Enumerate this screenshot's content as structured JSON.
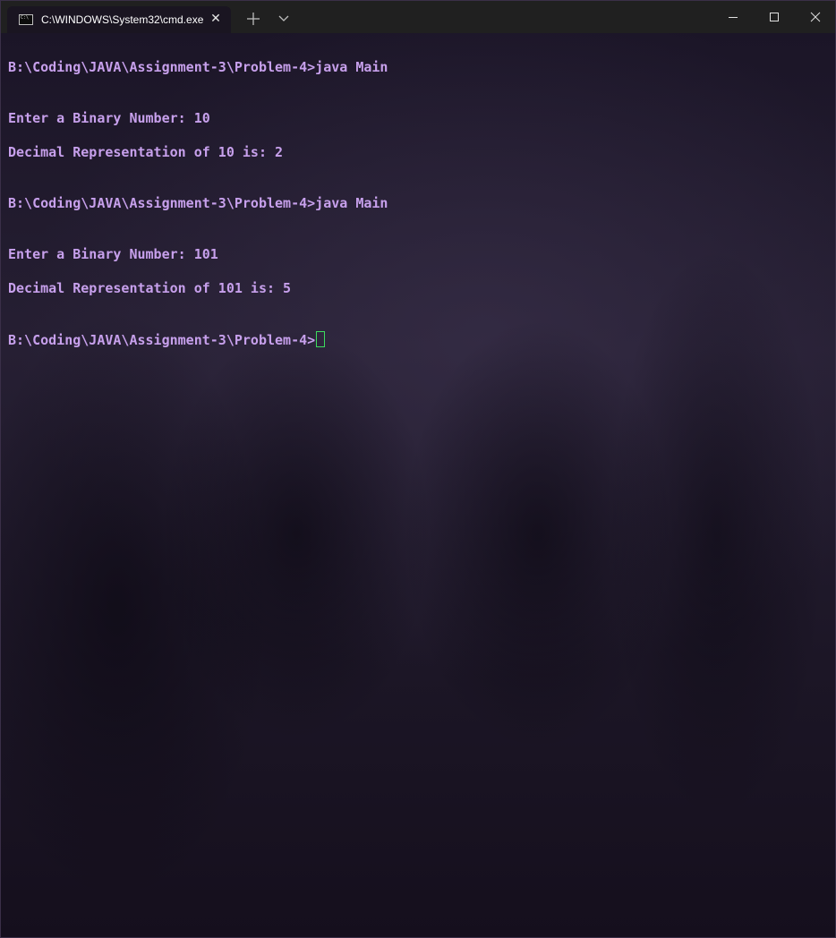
{
  "window": {
    "tab_title": "C:\\WINDOWS\\System32\\cmd.exe",
    "tab_icon_text": "C:\\"
  },
  "icons": {
    "tab": "cmd-icon",
    "tab_close": "close-icon",
    "new_tab": "plus-icon",
    "dropdown": "chevron-down-icon",
    "minimize": "minimize-icon",
    "maximize": "maximize-icon",
    "close": "close-icon"
  },
  "colors": {
    "terminal_text": "#c7a0ec",
    "cursor": "#3ddc5e",
    "titlebar": "#202020"
  },
  "terminal": {
    "lines": [
      "B:\\Coding\\JAVA\\Assignment-3\\Problem-4>java Main",
      "Enter a Binary Number: 10",
      "Decimal Representation of 10 is: 2",
      "B:\\Coding\\JAVA\\Assignment-3\\Problem-4>java Main",
      "Enter a Binary Number: 101",
      "Decimal Representation of 101 is: 5",
      "B:\\Coding\\JAVA\\Assignment-3\\Problem-4>"
    ]
  }
}
